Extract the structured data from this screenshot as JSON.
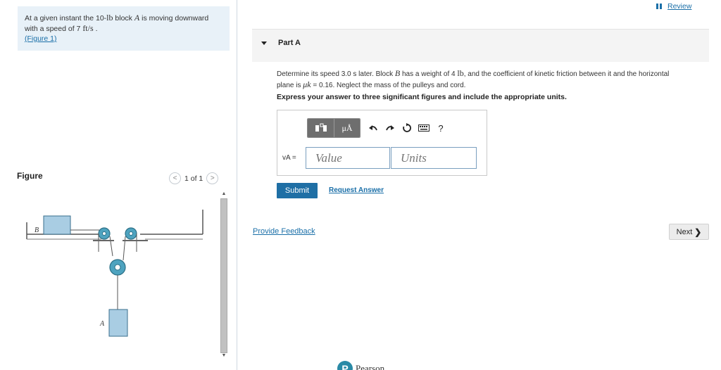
{
  "problem": {
    "text_before_A": "At a given instant the 10-",
    "unit_lb": "lb",
    "text_block": " block ",
    "block_A": "A",
    "text_after_A": " is moving downward with a speed of 7 ",
    "unit_speed": "ft/s",
    "text_end": " .",
    "figure_link": "(Figure 1)"
  },
  "figure_panel": {
    "title": "Figure",
    "pager_text": "1 of 1",
    "prev_icon": "chevron-left-icon",
    "next_icon": "chevron-right-icon",
    "label_B": "B",
    "label_A": "A"
  },
  "header": {
    "review_label": "Review"
  },
  "part": {
    "label": "Part A"
  },
  "question": {
    "line1_a": "Determine its speed 3.0 s later. Block ",
    "block_B": "B",
    "line1_b": " has a weight of 4 ",
    "unit_lb": "lb",
    "line1_c": ", and the coefficient of kinetic friction between it and the horizontal",
    "line2_a": "plane is ",
    "mu": "μk",
    "line2_b": " = 0.16. Neglect the mass of the pulleys and cord.",
    "instruction": "Express your answer to three significant figures and include the appropriate units."
  },
  "answer": {
    "toolbar": {
      "templates_icon": "templates-icon",
      "units_btn": "μÅ",
      "undo_icon": "undo-icon",
      "redo_icon": "redo-icon",
      "reset_icon": "reset-icon",
      "keyboard_icon": "keyboard-icon",
      "help": "?"
    },
    "variable_label": "vA =",
    "value_placeholder": "Value",
    "units_placeholder": "Units",
    "submit": "Submit",
    "request": "Request Answer"
  },
  "footer": {
    "feedback": "Provide Feedback",
    "next": "Next",
    "brand": "Pearson",
    "brand_logo": "P"
  },
  "colors": {
    "link": "#1a6fa8",
    "submit_bg": "#1f6fa5",
    "problem_bg": "#e8f1f8",
    "pulley": "#4ea3bf",
    "block": "#a9cde3"
  }
}
